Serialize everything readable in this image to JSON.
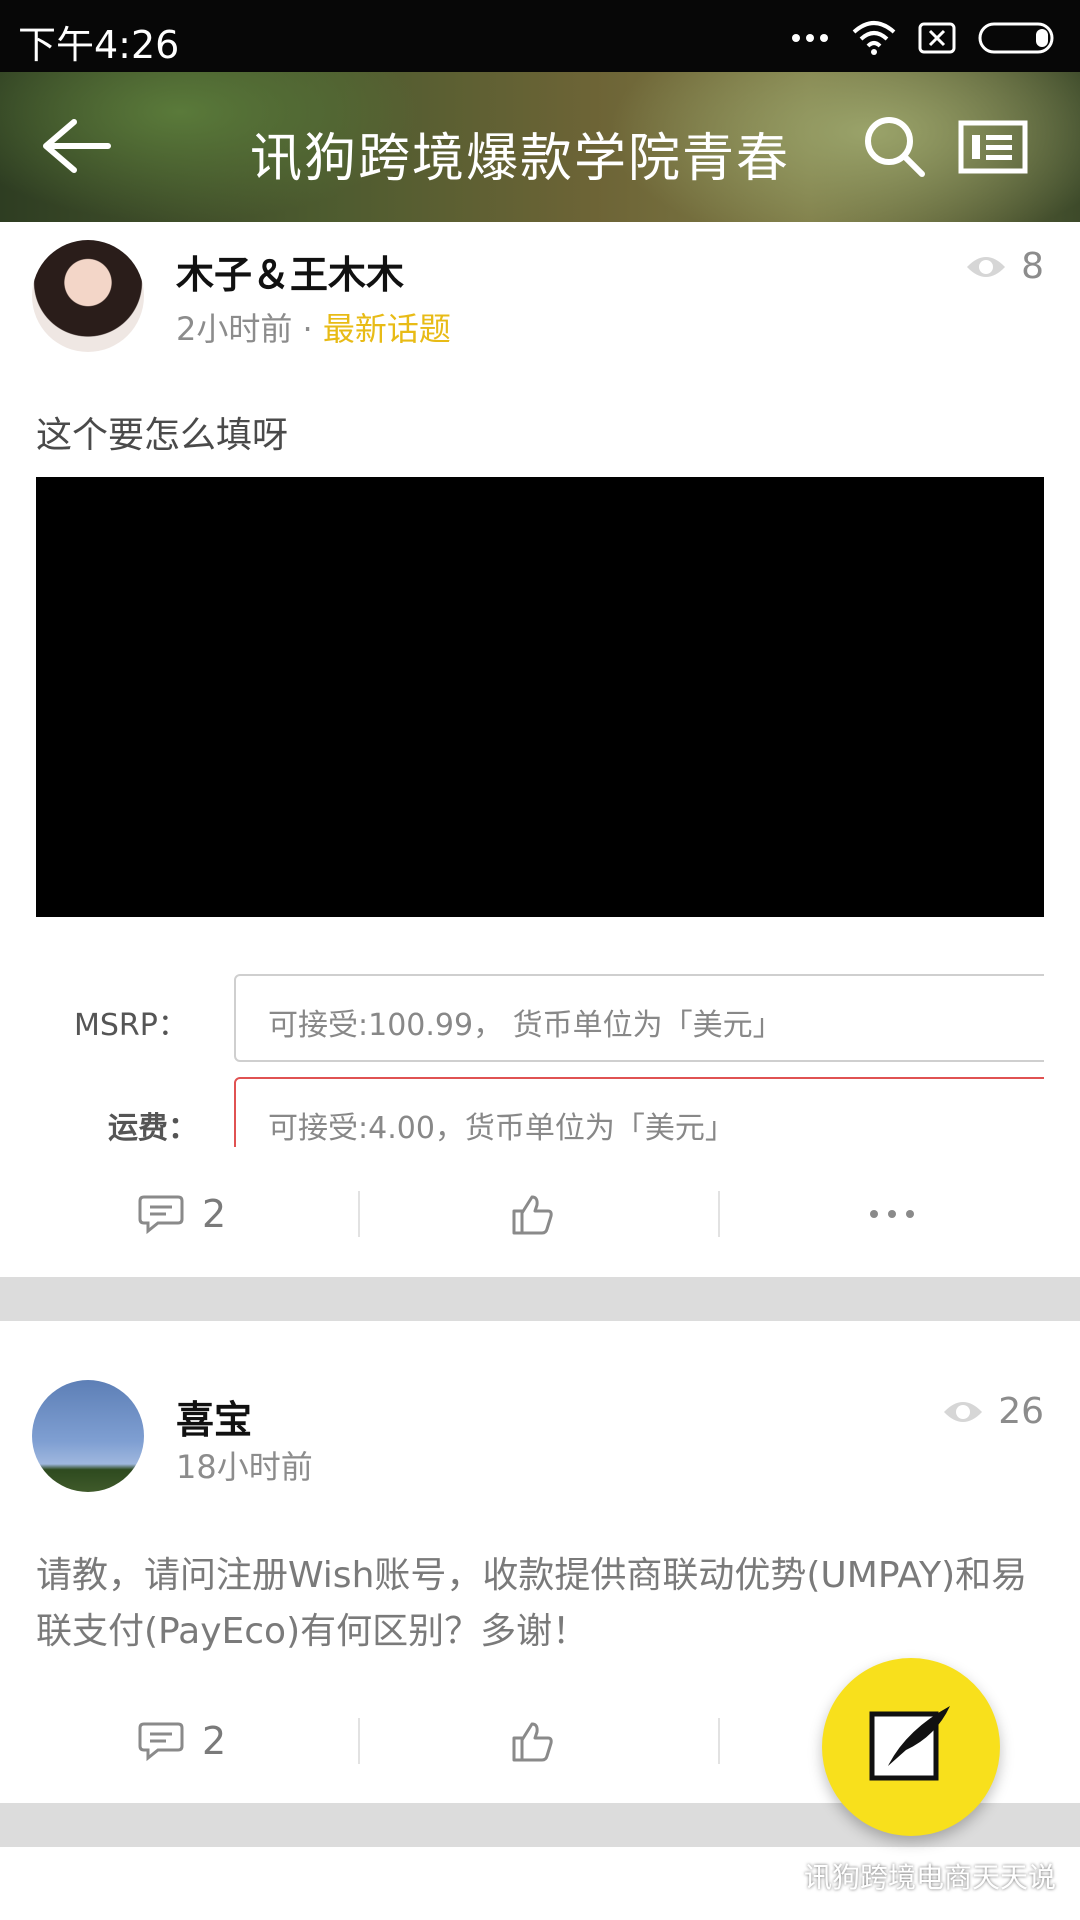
{
  "status_bar": {
    "time": "下午4:26"
  },
  "header": {
    "title": "讯狗跨境爆款学院青春"
  },
  "posts": [
    {
      "author": "木子＆王木木",
      "time": "2小时前",
      "separator": "·",
      "tag": "最新话题",
      "views": "8",
      "text": "这个要怎么填呀",
      "image_form": {
        "row1_label": "MSRP：",
        "row1_value": "可接受:100.99， 货币单位为「美元」",
        "row2_label": "运费：",
        "row2_value": "可接受:4.00，货币单位为「美元」"
      },
      "comments": "2"
    },
    {
      "author": "喜宝",
      "time": "18小时前",
      "views": "26",
      "text": "请教，请问注册Wish账号，收款提供商联动优势(UMPAY)和易联支付(PayEco)有何区别？多谢！",
      "comments": "2"
    }
  ],
  "watermark": "讯狗跨境电商天天说",
  "colors": {
    "accent": "#f8e01c",
    "tag": "#e8bb16",
    "separator_bg": "#dcdcdc"
  }
}
